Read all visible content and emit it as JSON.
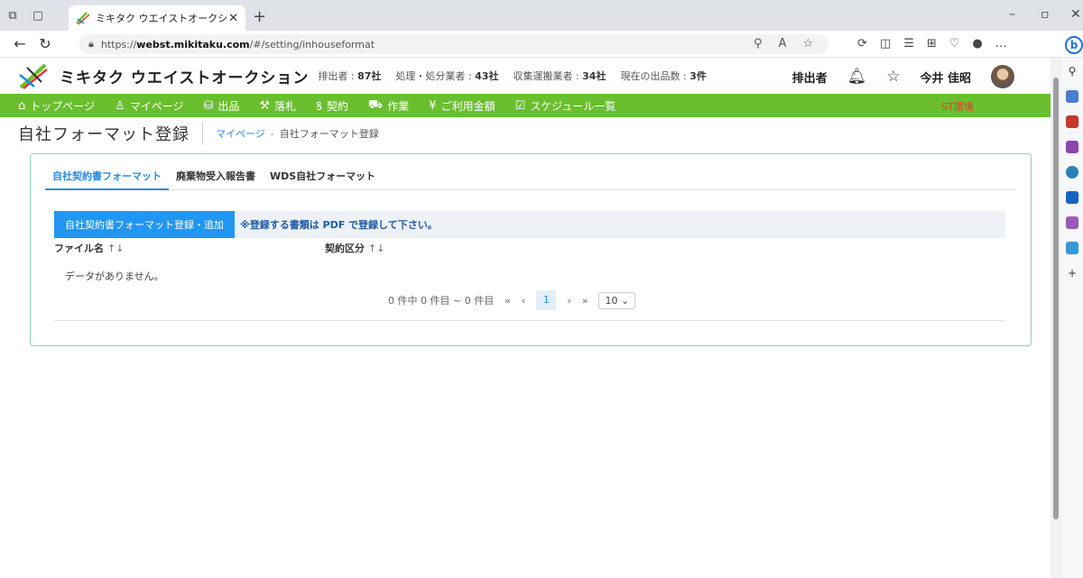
{
  "browser": {
    "tab_title": "ミキタク ウエイストオークション",
    "url_prefix": "https://",
    "url_host": "webst.mikitaku.com",
    "url_path": "/#/setting/inhouseformat"
  },
  "header": {
    "brand": "ミキタク ウエイストオークション",
    "stats": [
      {
        "label": "排出者 : ",
        "value": "87社"
      },
      {
        "label": "処理・処分業者 : ",
        "value": "43社"
      },
      {
        "label": "収集運搬業者 : ",
        "value": "34社"
      },
      {
        "label": "現在の出品数 : ",
        "value": "3件"
      }
    ],
    "role": "排出者",
    "user_name": "今井 佳昭"
  },
  "menu": {
    "items": [
      {
        "icon": "home-icon",
        "label": "トップページ"
      },
      {
        "icon": "user-icon",
        "label": "マイページ"
      },
      {
        "icon": "listing-icon",
        "label": "出品"
      },
      {
        "icon": "gavel-icon",
        "label": "落札"
      },
      {
        "icon": "contract-icon",
        "label": "契約"
      },
      {
        "icon": "work-icon",
        "label": "作業"
      },
      {
        "icon": "yen-icon",
        "label": "ご利用金額"
      },
      {
        "icon": "schedule-icon",
        "label": "スケジュール一覧"
      }
    ],
    "env_label": "ST環境"
  },
  "page": {
    "title": "自社フォーマット登録",
    "breadcrumb_link": "マイページ",
    "breadcrumb_sep": "-",
    "breadcrumb_current": "自社フォーマット登録"
  },
  "tabs": {
    "items": [
      "自社契約書フォーマット",
      "廃棄物受入報告書",
      "WDS自社フォーマット"
    ],
    "active": 0
  },
  "toolbar": {
    "add_button": "自社契約書フォーマット登録・追加",
    "note": "※登録する書類は PDF で登録して下さい。"
  },
  "table": {
    "columns": [
      "ファイル名",
      "契約区分"
    ],
    "empty_text": "データがありません。"
  },
  "pager": {
    "summary": "0 件中 0 件目 ~ 0 件目",
    "current_page": "1",
    "page_size": "10"
  },
  "colors": {
    "menu_green": "#6abf2e",
    "accent_blue": "#2196f3",
    "card_border": "#8ed4b8",
    "env_red": "#e53935"
  }
}
